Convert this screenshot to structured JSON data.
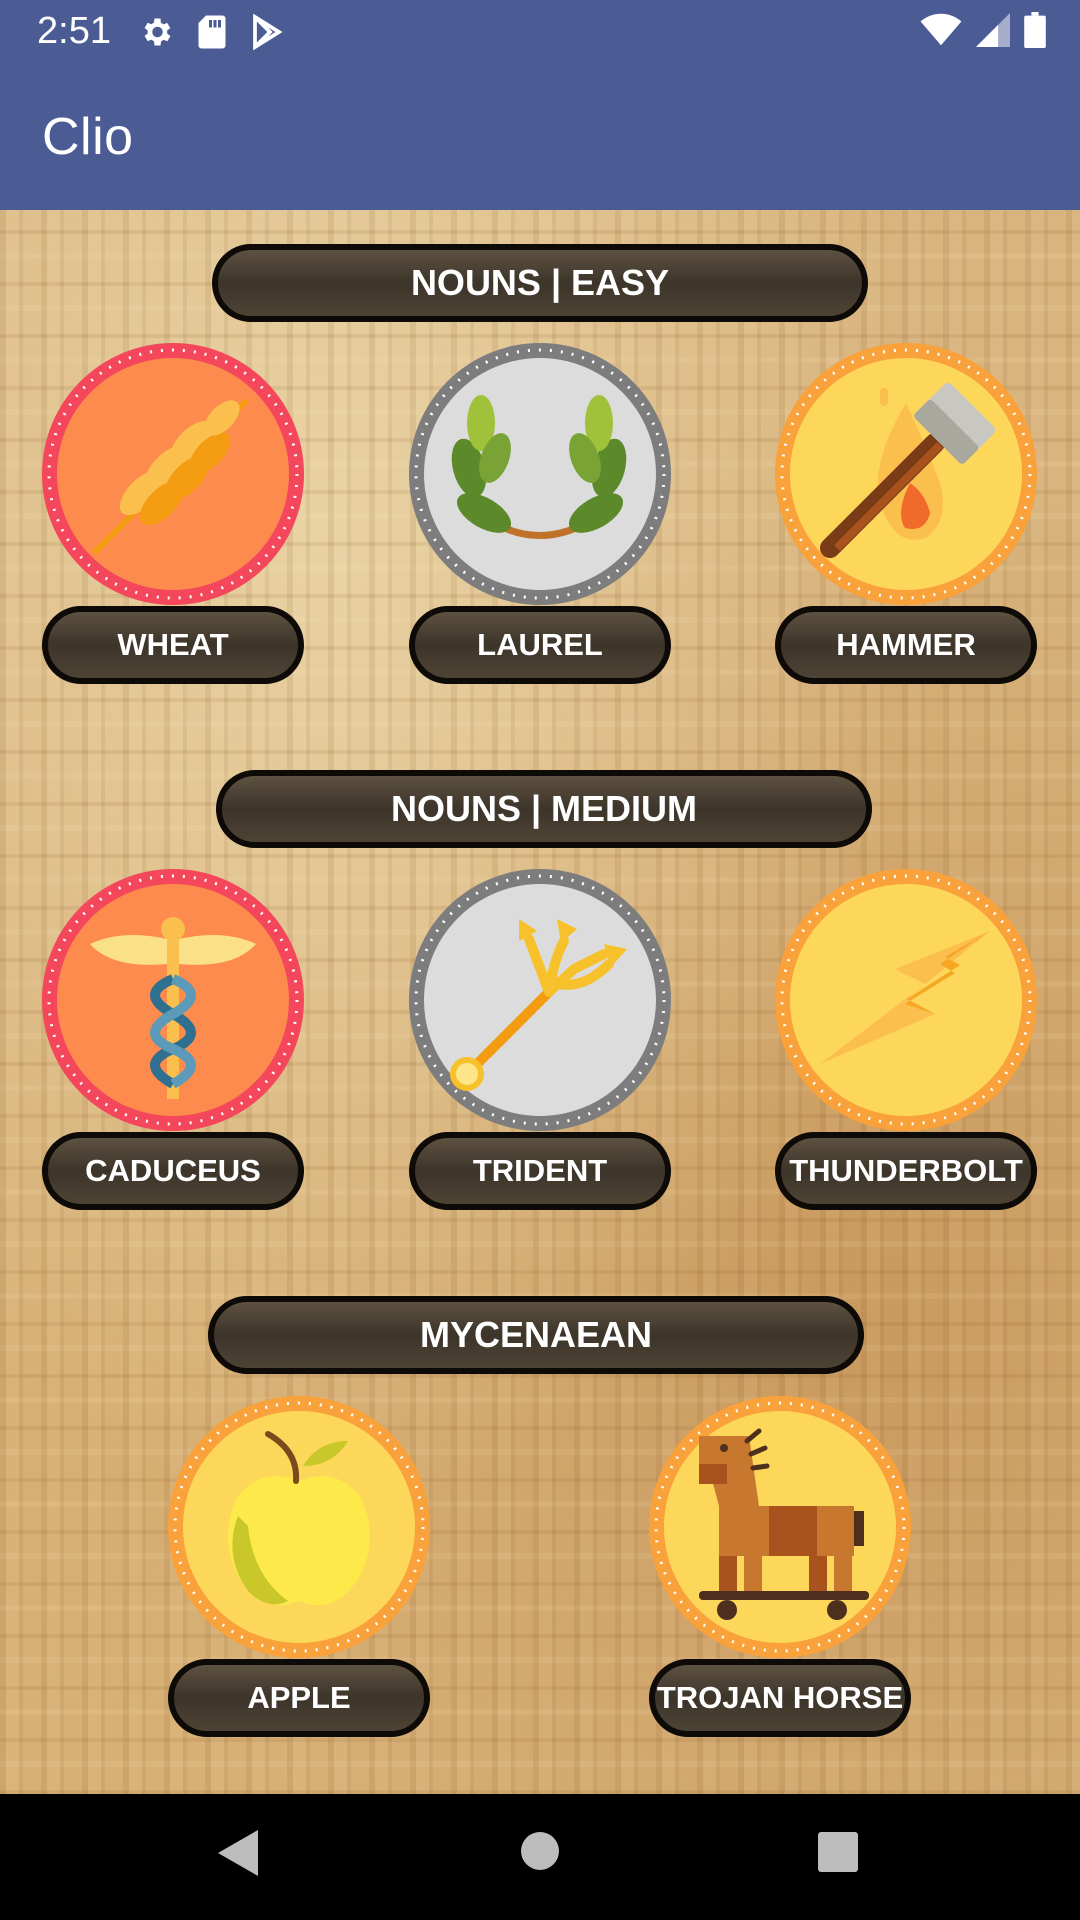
{
  "status_bar": {
    "time": "2:51",
    "icons_left": [
      "gear-icon",
      "sd-card-icon",
      "play-store-icon"
    ],
    "icons_right": [
      "wifi-icon",
      "cell-signal-icon",
      "battery-icon"
    ]
  },
  "app_bar": {
    "title": "Clio"
  },
  "sections": [
    {
      "title": "NOUNS | EASY",
      "items": [
        {
          "label": "WHEAT",
          "icon": "wheat-icon"
        },
        {
          "label": "LAUREL",
          "icon": "laurel-icon"
        },
        {
          "label": "HAMMER",
          "icon": "hammer-icon"
        }
      ]
    },
    {
      "title": "NOUNS | MEDIUM",
      "items": [
        {
          "label": "CADUCEUS",
          "icon": "caduceus-icon"
        },
        {
          "label": "TRIDENT",
          "icon": "trident-icon"
        },
        {
          "label": "THUNDERBOLT",
          "icon": "thunderbolt-icon"
        }
      ]
    },
    {
      "title": "MYCENAEAN",
      "items": [
        {
          "label": "APPLE",
          "icon": "apple-icon"
        },
        {
          "label": "TROJAN HORSE",
          "icon": "trojan-horse-icon"
        }
      ]
    }
  ],
  "nav_bar": {
    "buttons": [
      "back-icon",
      "home-icon",
      "recents-icon"
    ]
  },
  "colors": {
    "app_bar": "#4b5b94",
    "badge_red_ring": "#f4475c",
    "badge_red_fill": "#fc8b4d",
    "badge_silver_ring": "#7d7d7d",
    "badge_silver_fill": "#dcdcdc",
    "badge_gold_ring": "#f9a13a",
    "badge_gold_fill": "#fdd75a"
  }
}
